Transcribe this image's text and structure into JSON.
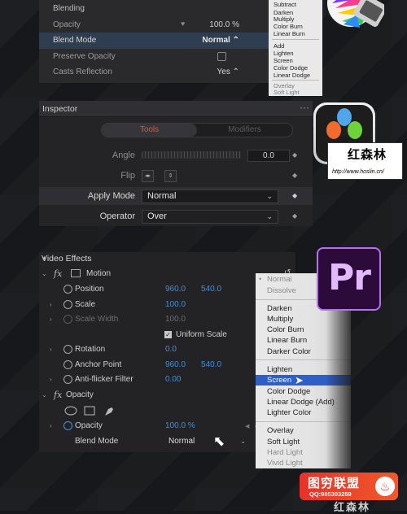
{
  "fcp": {
    "rows": [
      {
        "label": "Blending"
      },
      {
        "label": "Opacity",
        "value": "100.0 %"
      },
      {
        "label": "Blend Mode",
        "value": "Normal ⌃"
      },
      {
        "label": "Preserve Opacity"
      },
      {
        "label": "Casts Reflection",
        "value": "Yes ⌃"
      }
    ],
    "menu_items": [
      "Subtract",
      "Darken",
      "Multiply",
      "Color Burn",
      "Linear Burn",
      "Add",
      "Lighten",
      "Screen",
      "Color Dodge",
      "Linear Dodge",
      "Overlay",
      "Soft Light"
    ]
  },
  "davinci": {
    "title": "Inspector",
    "menu_icon": "···",
    "tabs": {
      "tools": "Tools",
      "modifiers": "Modifiers"
    },
    "angle": {
      "label": "Angle",
      "value": "0.0"
    },
    "flip": {
      "label": "Flip"
    },
    "apply_mode": {
      "label": "Apply Mode",
      "value": "Normal"
    },
    "operator": {
      "label": "Operator",
      "value": "Over"
    }
  },
  "watermark": {
    "brand": "红森林",
    "url": "http://www.hoslin.cn/"
  },
  "premiere_icon": {
    "text": "Pr"
  },
  "premiere": {
    "title": "Video Effects",
    "motion": {
      "label": "Motion"
    },
    "position": {
      "label": "Position",
      "x": "960.0",
      "y": "540.0"
    },
    "scale": {
      "label": "Scale",
      "value": "100.0"
    },
    "scale_width": {
      "label": "Scale Width",
      "value": "100.0"
    },
    "uniform_scale": {
      "label": "Uniform Scale",
      "check": "✓"
    },
    "rotation": {
      "label": "Rotation",
      "value": "0.0"
    },
    "anchor_point": {
      "label": "Anchor Point",
      "x": "960.0",
      "y": "540.0"
    },
    "anti_flicker": {
      "label": "Anti-flicker Filter",
      "value": "0.00"
    },
    "opacity_group": {
      "label": "Opacity"
    },
    "opacity": {
      "label": "Opacity",
      "value": "100.0 %"
    },
    "blend_mode": {
      "label": "Blend Mode",
      "value": "Normal"
    },
    "reset_icon": "↺",
    "fx": "fx",
    "menu": [
      {
        "label": "Normal",
        "dim": true,
        "dot": "•"
      },
      {
        "label": "Dissolve",
        "dim": true
      },
      {
        "label": "Darken"
      },
      {
        "label": "Multiply"
      },
      {
        "label": "Color Burn"
      },
      {
        "label": "Linear Burn"
      },
      {
        "label": "Darker Color"
      },
      {
        "label": "Lighten"
      },
      {
        "label": "Screen",
        "selected": true
      },
      {
        "label": "Color Dodge"
      },
      {
        "label": "Linear Dodge (Add)"
      },
      {
        "label": "Lighter Color"
      },
      {
        "label": "Overlay"
      },
      {
        "label": "Soft Light"
      },
      {
        "label": "Hard Light",
        "dim": true
      },
      {
        "label": "Vivid Light",
        "dim": true
      }
    ]
  },
  "logo": {
    "title": "图穷联盟",
    "sub": "QQ:985303259"
  },
  "bottom_brand": "红森林",
  "colors": {
    "accent_blue": "#3c8fe2",
    "davinci_orange": "#e8522f",
    "premiere_purple": "#b86ef0",
    "logo_red": "#e8322b"
  }
}
